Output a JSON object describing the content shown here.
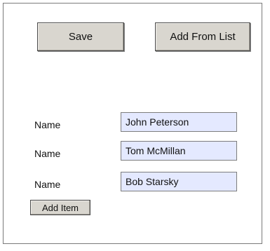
{
  "toolbar": {
    "save_label": "Save",
    "add_from_list_label": "Add From List"
  },
  "rows": [
    {
      "label": "Name",
      "value": "John Peterson"
    },
    {
      "label": "Name",
      "value": "Tom McMillan"
    },
    {
      "label": "Name",
      "value": "Bob Starsky"
    }
  ],
  "actions": {
    "add_item_label": "Add Item"
  },
  "colors": {
    "button_face": "#d9d6cf",
    "input_background": "#e4e9ff",
    "frame_border": "#7a7a7a"
  }
}
